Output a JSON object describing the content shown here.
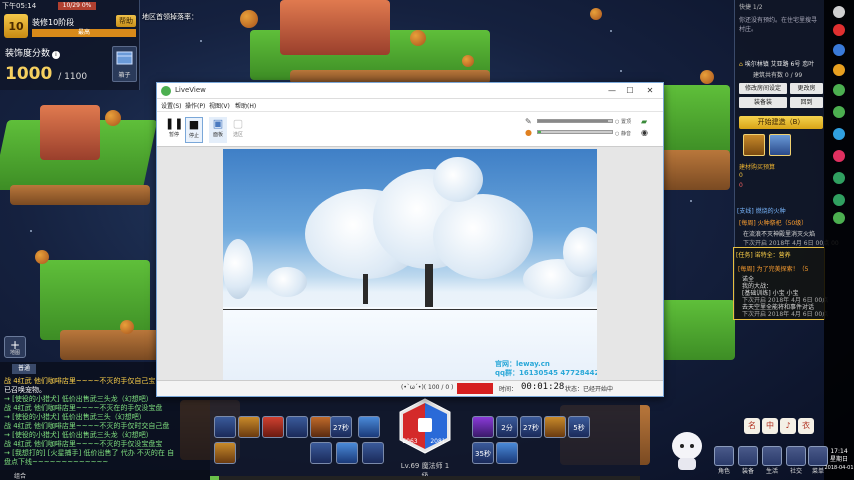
{
  "game": {
    "time_label": "下午05:14",
    "top_strip": "10/29 0%",
    "level": "10",
    "stage_title": "装修10阶段",
    "help_button": "帮助",
    "progress_bar_label": "最高",
    "score_label": "装饰度分数",
    "info_icon": "i",
    "score_value": "1000",
    "score_max": "/ 1100",
    "box_button_label": "箱子",
    "map_label": "地区首领掉落率：",
    "map_button_plus": "+",
    "map_button_label": "地图"
  },
  "right_panel": {
    "header": "快捷 1/2",
    "notice": "你还没有预约。在住宅里搜寻村庄。",
    "address": "埃尔林镇 艾亚路 6号 恋叶",
    "count": "建筑共有数 0 / 99",
    "buttons": [
      "修改房间设定",
      "更改房",
      "装备装",
      "回到"
    ],
    "build_button": "开始建造（B）",
    "purchase_label": "建材购买预算",
    "gold_1": "0",
    "gold_2": "0",
    "quest_1_tag": "[支线] 燃烧的火种",
    "quest_1_title": "[每周] 火种祭祀（50级）",
    "quest_1_desc": "在流浪不灭神殿里消灭火焰",
    "quest_1_time": "下次开启 2018年 4月 6日 00点 00",
    "quest_2_tag": "[任务] 诺特全：营养",
    "quest_2_title": "[每周] 为了完美探索！（5",
    "quest_2_lines": [
      "诺全",
      "我的大战：",
      "[基础训练] 小宝 小宝",
      "下次开启 2018年 4月 6日 00点",
      "去天空里全能将和事件对话",
      "下次开启 2018年 4月 6日 00点"
    ]
  },
  "chat": {
    "tab": "普通",
    "lines": [
      {
        "text": "战 4红武 他们咖啡店里~~~~不灭的手仅自己宝",
        "color": "#ffd24a"
      },
      {
        "text": "已召唤宠物。",
        "color": "#ffffff"
      },
      {
        "text": "→ [使役的小猎犬] 低价出售武三头龙（幻想吧）",
        "color": "#7fe07f"
      },
      {
        "text": "战 4红武 他们咖啡店里~~~~不灭在的手仅没宝盘",
        "color": "#7fe07f"
      },
      {
        "text": "→ [使役的小猎犬] 低价出售武三头（幻想吧）",
        "color": "#7fe07f"
      },
      {
        "text": "战 4红武 他们咖啡店里~~~~不灭的手仅时交自己盘",
        "color": "#7fe07f"
      },
      {
        "text": "→ [使役的小猎犬] 低价出售武三头龙（幻想吧）",
        "color": "#7fe07f"
      },
      {
        "text": "战 4红武 他们咖啡店里~~~~不灭的手仅没宝盘宝",
        "color": "#7fe07f"
      },
      {
        "text": "→ [我想打的] [火星捕手] 低价出售了 代办 不灭的在 自",
        "color": "#7fe07f"
      },
      {
        "text": "盘点下线~~~~~~~~~~~~~",
        "color": "#7fe07f"
      }
    ],
    "footer": "组合"
  },
  "skills": {
    "cooldown_1": "27秒",
    "cooldown_2": "2分",
    "cooldown_3": "27秒",
    "cooldown_4": "35秒",
    "cooldown_5": "5秒",
    "hp_value": "5063",
    "mp_value": "2081",
    "level_text": "Lv.69 魔法师 1级",
    "exp_fraction": 0.02
  },
  "hud_right": {
    "icons": [
      "名",
      "中",
      "♪",
      "衣"
    ],
    "menus": [
      "角色",
      "装备",
      "生活",
      "社交",
      "菜单"
    ],
    "time": "17:14",
    "weekday": "星期日",
    "date": "2018-04-01"
  },
  "liveview": {
    "title": "LiveView",
    "menu": [
      "设置(S)",
      "操作(P)",
      "视图(V)",
      "帮助(H)"
    ],
    "tools": [
      {
        "icon": "❚❚",
        "label": "暂停"
      },
      {
        "icon": "■",
        "label": "停止"
      },
      {
        "icon": "▣",
        "label": "面板"
      },
      {
        "icon": "▢",
        "label": "选区"
      }
    ],
    "checkbox_1": "置顶",
    "checkbox_2": "静音",
    "win_min": "—",
    "win_max": "☐",
    "win_close": "✕",
    "watermark_line1": "官网：leway.cn",
    "watermark_line2": "qq群：16130545 477284426",
    "status_left": "(•`ω´•)( 100 / 0 )",
    "status_time_label": "时间：",
    "timer": "00:01:28",
    "status_label": "状态：",
    "status_value": "已经开始中"
  }
}
